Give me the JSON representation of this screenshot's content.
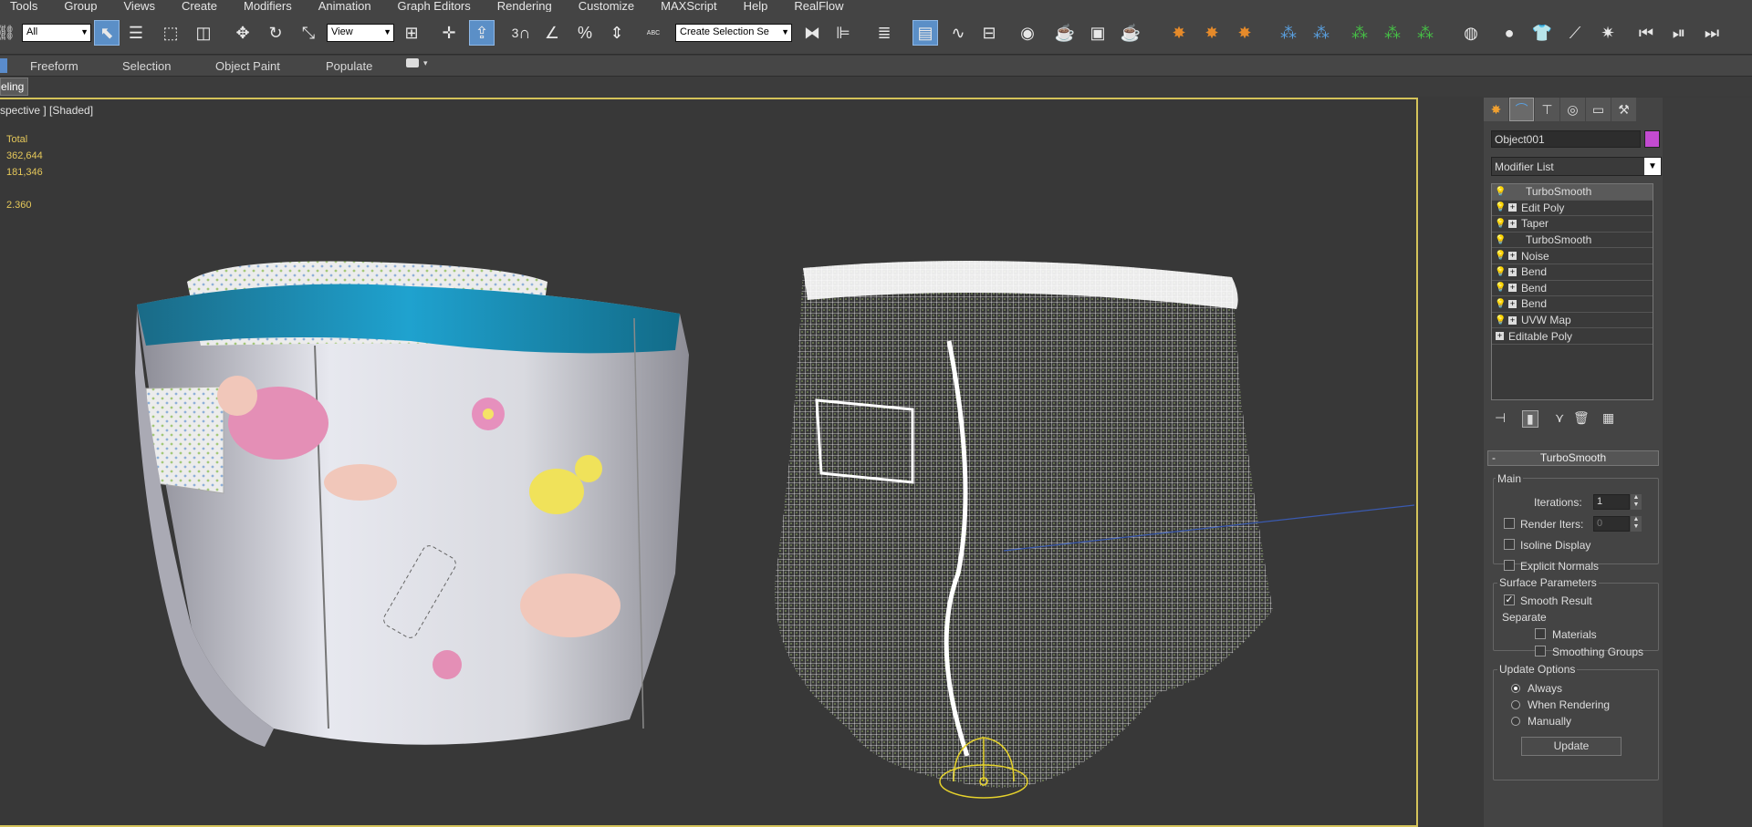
{
  "menu": [
    "Tools",
    "Group",
    "Views",
    "Create",
    "Modifiers",
    "Animation",
    "Graph Editors",
    "Rendering",
    "Customize",
    "MAXScript",
    "Help",
    "RealFlow"
  ],
  "toolbar": {
    "filter_value": "All",
    "refcoord_value": "View",
    "snap_label": "3",
    "named_selection": "Create Selection Se",
    "abc_label": "ABC"
  },
  "ribbon": {
    "tabs": [
      "Freeform",
      "Selection",
      "Object Paint",
      "Populate"
    ],
    "mode_tab": "eling"
  },
  "viewport": {
    "label": "spective ] [Shaded]",
    "stats": [
      "Total",
      "362,644",
      "181,346",
      "",
      "2.360"
    ]
  },
  "command_panel": {
    "object_name": "Object001",
    "object_color": "#c34bd1",
    "modifier_list": "Modifier List",
    "stack": [
      {
        "label": "TurboSmooth",
        "plus": false,
        "indent": true,
        "selected": true
      },
      {
        "label": "Edit Poly",
        "plus": true,
        "indent": true,
        "selected": false
      },
      {
        "label": "Taper",
        "plus": true,
        "indent": true,
        "selected": false
      },
      {
        "label": "TurboSmooth",
        "plus": false,
        "indent": true,
        "selected": false
      },
      {
        "label": "Noise",
        "plus": true,
        "indent": true,
        "selected": false
      },
      {
        "label": "Bend",
        "plus": true,
        "indent": true,
        "selected": false
      },
      {
        "label": "Bend",
        "plus": true,
        "indent": true,
        "selected": false
      },
      {
        "label": "Bend",
        "plus": true,
        "indent": true,
        "selected": false
      },
      {
        "label": "UVW Map",
        "plus": true,
        "indent": true,
        "selected": false
      },
      {
        "label": "Editable Poly",
        "plus": true,
        "indent": false,
        "selected": false
      }
    ],
    "rollout": {
      "title": "TurboSmooth",
      "collapse": "-",
      "main": "Main",
      "iterations_label": "Iterations:",
      "iterations_value": "1",
      "render_iters_label": "Render Iters:",
      "render_iters_value": "0",
      "isoline": "Isoline Display",
      "explicit": "Explicit Normals",
      "surface": "Surface Parameters",
      "smooth_result": "Smooth Result",
      "separate": "Separate",
      "materials": "Materials",
      "smoothing_groups": "Smoothing Groups",
      "update_options": "Update Options",
      "always": "Always",
      "when_rendering": "When Rendering",
      "manually": "Manually",
      "update_btn": "Update"
    }
  }
}
